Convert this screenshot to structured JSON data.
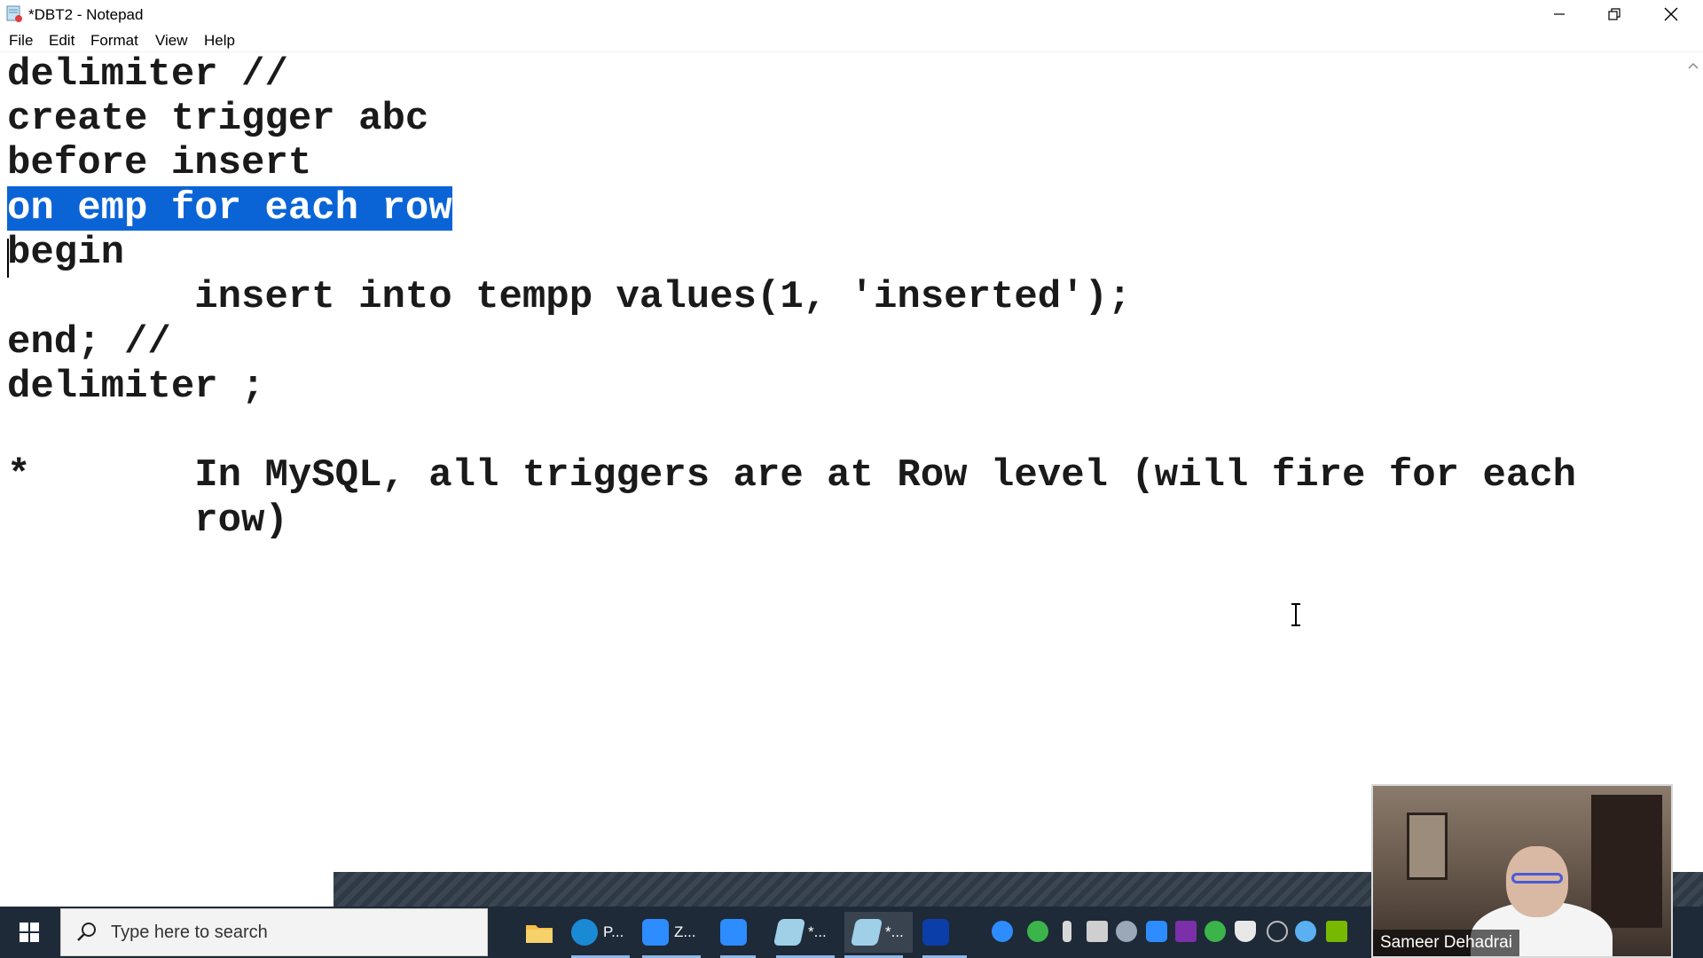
{
  "window": {
    "title": "*DBT2 - Notepad",
    "controls": {
      "minimize": "minimize-icon",
      "restore": "restore-icon",
      "close": "close-icon"
    }
  },
  "menu": {
    "items": [
      "File",
      "Edit",
      "Format",
      "View",
      "Help"
    ]
  },
  "editor": {
    "lines": [
      "delimiter //",
      "create trigger abc",
      "before insert",
      "on emp for each row",
      "begin",
      "        insert into tempp values(1, 'inserted');",
      "end; //",
      "delimiter ;",
      "",
      "*       In MySQL, all triggers are at Row level (will fire for each",
      "        row)"
    ],
    "selected_line": "on emp for each row"
  },
  "taskbar": {
    "search_placeholder": "Type here to search",
    "apps": [
      {
        "label": "P...",
        "icon": "edge-icon",
        "color": "#1a8ad4"
      },
      {
        "label": "Z...",
        "icon": "zoom-icon",
        "color": "#2d8cff"
      },
      {
        "label": "",
        "icon": "zoom-meeting-icon",
        "color": "#2d8cff"
      },
      {
        "label": "*...",
        "icon": "notepad-icon",
        "color": "#9fd0e8"
      },
      {
        "label": "*...",
        "icon": "notepad-icon",
        "color": "#9fd0e8"
      },
      {
        "label": "",
        "icon": "chart-app-icon",
        "color": "#0b3ea8"
      }
    ]
  },
  "webcam": {
    "name": "Sameer Dehadrai"
  },
  "colors": {
    "selection": "#0a64d6",
    "taskbar": "#1e2a38"
  }
}
